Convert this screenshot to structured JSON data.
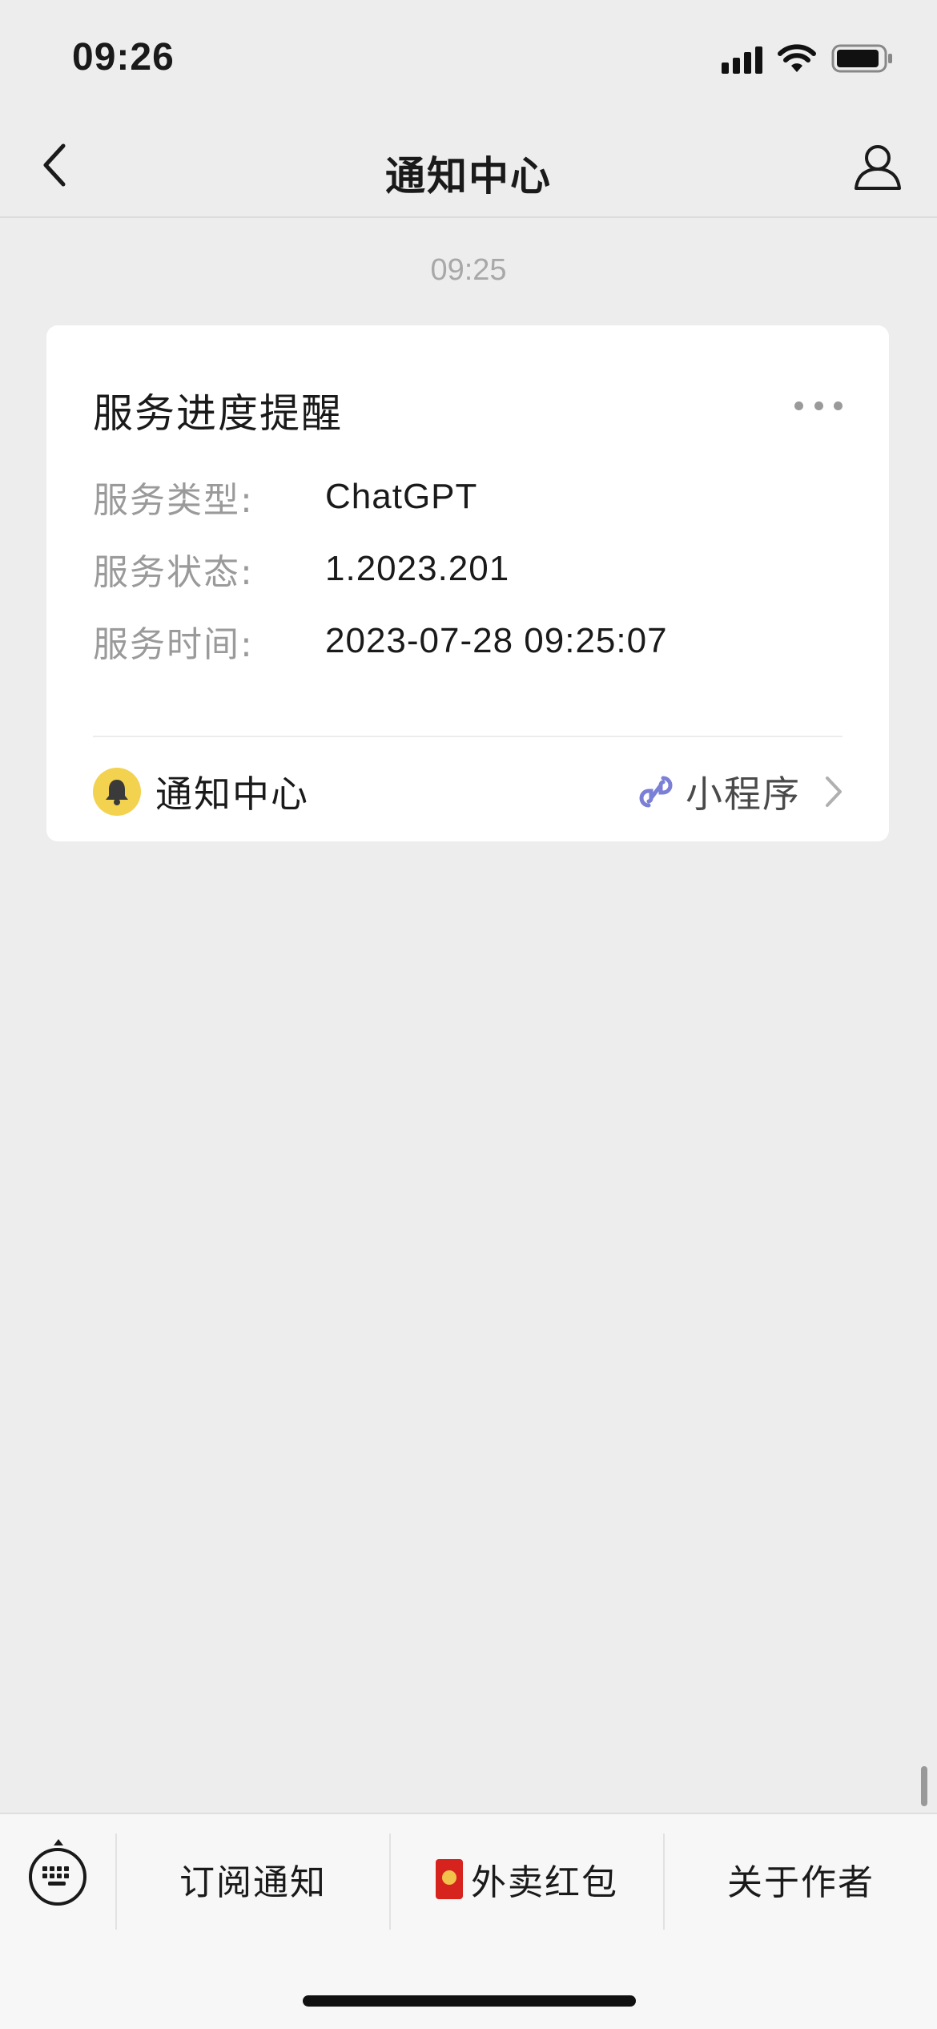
{
  "status_bar": {
    "time": "09:26"
  },
  "nav": {
    "title": "通知中心"
  },
  "message": {
    "timestamp": "09:25"
  },
  "card": {
    "title": "服务进度提醒",
    "fields": [
      {
        "label": "服务类型:",
        "value": "ChatGPT"
      },
      {
        "label": "服务状态:",
        "value": "1.2023.201"
      },
      {
        "label": "服务时间:",
        "value": "2023-07-28 09:25:07"
      }
    ],
    "footer": {
      "source_name": "通知中心",
      "mini_program_label": "小程序"
    }
  },
  "bottom_menu": {
    "items": [
      {
        "label": "订阅通知"
      },
      {
        "label": "外卖红包",
        "icon": "red-packet-icon"
      },
      {
        "label": "关于作者"
      }
    ]
  },
  "colors": {
    "background": "#ededed",
    "card": "#ffffff",
    "avatar": "#f3d250",
    "link_icon": "#7b7fd6",
    "red_packet": "#d6231e"
  }
}
